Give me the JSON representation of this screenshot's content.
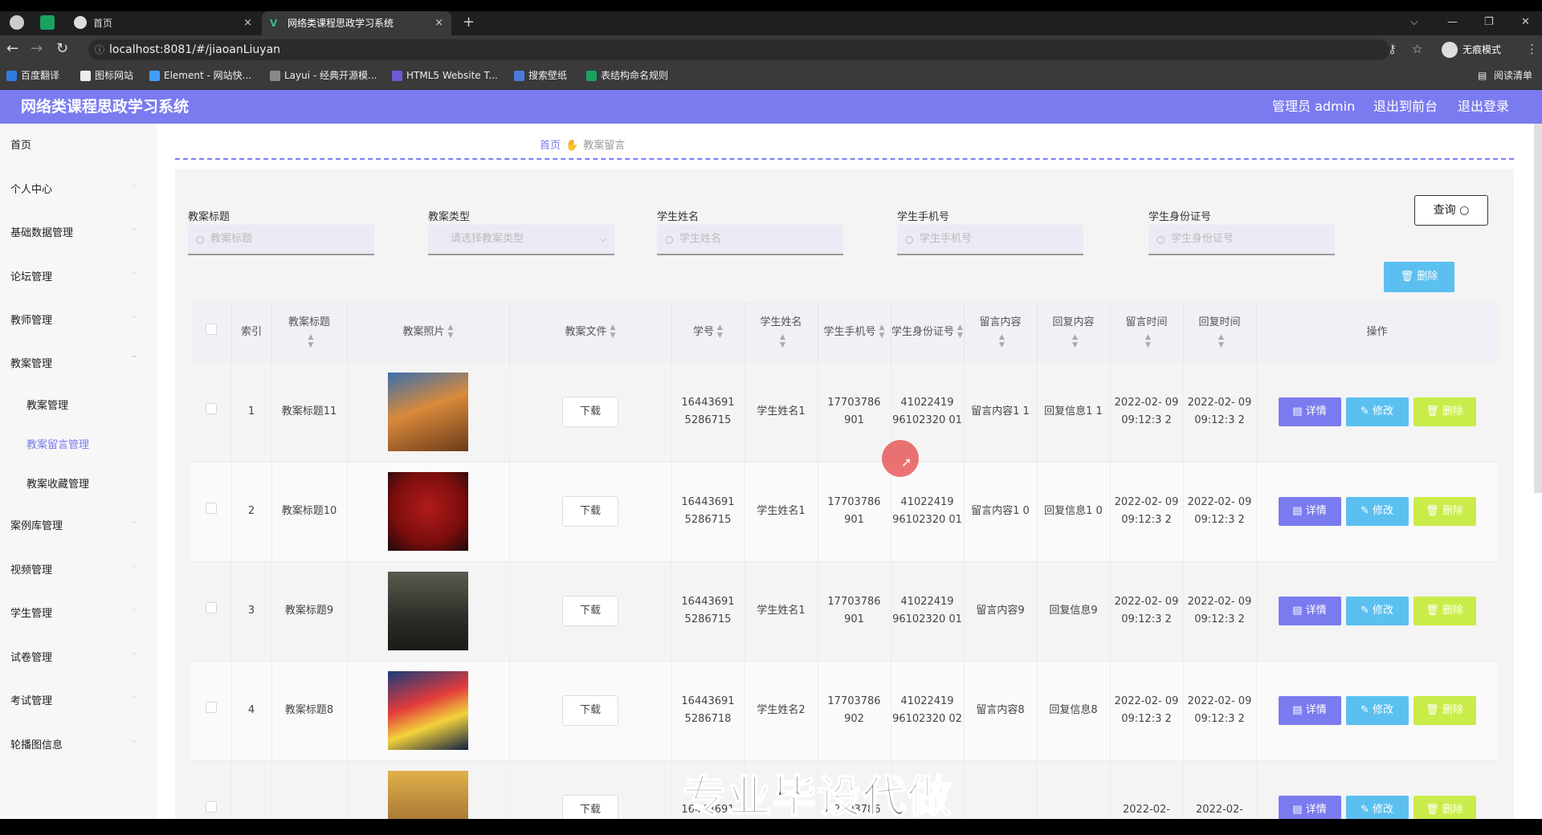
{
  "browser": {
    "tabs": [
      {
        "label": "首页",
        "close": "×"
      },
      {
        "label": "网络类课程思政学习系统",
        "close": "×"
      }
    ],
    "new_tab": "+",
    "url": "localhost:8081/#/jiaoanLiuyan",
    "incognito_label": "无痕模式",
    "bookmarks": [
      "百度翻译",
      "图标网站",
      "Element - 网站快...",
      "Layui - 经典开源模...",
      "HTML5 Website T...",
      "搜索壁纸",
      "表结构命名规则"
    ],
    "reading_list": "阅读清单"
  },
  "header": {
    "title": "网络类课程思政学习系统",
    "admin": "管理员 admin",
    "to_front": "退出到前台",
    "logout": "退出登录"
  },
  "sidebar": {
    "items": [
      "首页",
      "个人中心",
      "基础数据管理",
      "论坛管理",
      "教师管理",
      "教案管理",
      "案例库管理",
      "视频管理",
      "学生管理",
      "试卷管理",
      "考试管理",
      "轮播图信息"
    ],
    "sub_items": [
      "教案管理",
      "教案留言管理",
      "教案收藏管理"
    ]
  },
  "breadcrumb": {
    "home": "首页",
    "current": "教案留言"
  },
  "filters": {
    "title_label": "教案标题",
    "title_placeholder": "教案标题",
    "type_label": "教案类型",
    "type_placeholder": "请选择教案类型",
    "name_label": "学生姓名",
    "name_placeholder": "学生姓名",
    "phone_label": "学生手机号",
    "phone_placeholder": "学生手机号",
    "id_label": "学生身份证号",
    "id_placeholder": "学生身份证号",
    "query_button": "查询",
    "delete_button": "删除"
  },
  "table": {
    "headers": {
      "index": "索引",
      "title": "教案标题",
      "photo": "教案照片",
      "file": "教案文件",
      "sno": "学号",
      "sname": "学生姓名",
      "sphone": "学生手机号",
      "sid": "学生身份证号",
      "msg": "留言内容",
      "reply": "回复内容",
      "msg_time": "留言时间",
      "reply_time": "回复时间",
      "ops": "操作"
    },
    "download_label": "下载",
    "detail_label": "详情",
    "edit_label": "修改",
    "delete_label": "删除",
    "rows": [
      {
        "index": "1",
        "title": "教案标题11",
        "sno": "16443691 5286715",
        "sname": "学生姓名1",
        "sphone": "17703786 901",
        "sid": "41022419 96102320 01",
        "msg": "留言内容1 1",
        "reply": "回复信息1 1",
        "msg_time": "2022-02- 09 09:12:3 2",
        "reply_time": "2022-02- 09 09:12:3 2"
      },
      {
        "index": "2",
        "title": "教案标题10",
        "sno": "16443691 5286715",
        "sname": "学生姓名1",
        "sphone": "17703786 901",
        "sid": "41022419 96102320 01",
        "msg": "留言内容1 0",
        "reply": "回复信息1 0",
        "msg_time": "2022-02- 09 09:12:3 2",
        "reply_time": "2022-02- 09 09:12:3 2"
      },
      {
        "index": "3",
        "title": "教案标题9",
        "sno": "16443691 5286715",
        "sname": "学生姓名1",
        "sphone": "17703786 901",
        "sid": "41022419 96102320 01",
        "msg": "留言内容9",
        "reply": "回复信息9",
        "msg_time": "2022-02- 09 09:12:3 2",
        "reply_time": "2022-02- 09 09:12:3 2"
      },
      {
        "index": "4",
        "title": "教案标题8",
        "sno": "16443691 5286718",
        "sname": "学生姓名2",
        "sphone": "17703786 902",
        "sid": "41022419 96102320 02",
        "msg": "留言内容8",
        "reply": "回复信息8",
        "msg_time": "2022-02- 09 09:12:3 2",
        "reply_time": "2022-02- 09 09:12:3 2"
      },
      {
        "index": "",
        "title": "",
        "sno": "16443691",
        "sname": "",
        "sphone": "17703786",
        "sid": "",
        "msg": "",
        "reply": "",
        "msg_time": "2022-02-",
        "reply_time": "2022-02-"
      }
    ]
  },
  "watermark": "专业毕设代做",
  "colors": {
    "accent": "#7b7bf0",
    "info": "#5bc0f0",
    "danger": "#c9ec4a"
  }
}
